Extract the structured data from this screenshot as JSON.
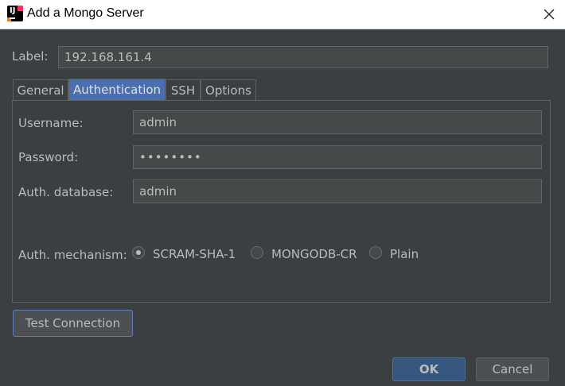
{
  "window": {
    "title": "Add a Mongo Server",
    "icon": "intellij-app-icon",
    "icon_text": "IJ",
    "close_icon": "close-icon"
  },
  "label": {
    "caption": "Label:",
    "value": "192.168.161.4"
  },
  "tabs": [
    {
      "label": "General",
      "active": false
    },
    {
      "label": "Authentication",
      "active": true
    },
    {
      "label": "SSH",
      "active": false
    },
    {
      "label": "Options",
      "active": false
    }
  ],
  "auth": {
    "username_label": "Username:",
    "username_value": "admin",
    "password_label": "Password:",
    "password_value": "••••••••",
    "database_label": "Auth. database:",
    "database_value": "admin",
    "mechanism_label": "Auth. mechanism:",
    "mechanisms": [
      {
        "label": "SCRAM-SHA-1",
        "selected": true
      },
      {
        "label": "MONGODB-CR",
        "selected": false
      },
      {
        "label": "Plain",
        "selected": false
      }
    ]
  },
  "buttons": {
    "test_connection": "Test Connection",
    "ok": "OK",
    "cancel": "Cancel"
  },
  "colors": {
    "background": "#3c3f41",
    "text": "#bbbbbb",
    "active_tab": "#4b6eaf",
    "ok_button": "#365880",
    "field_background": "#45494a"
  }
}
